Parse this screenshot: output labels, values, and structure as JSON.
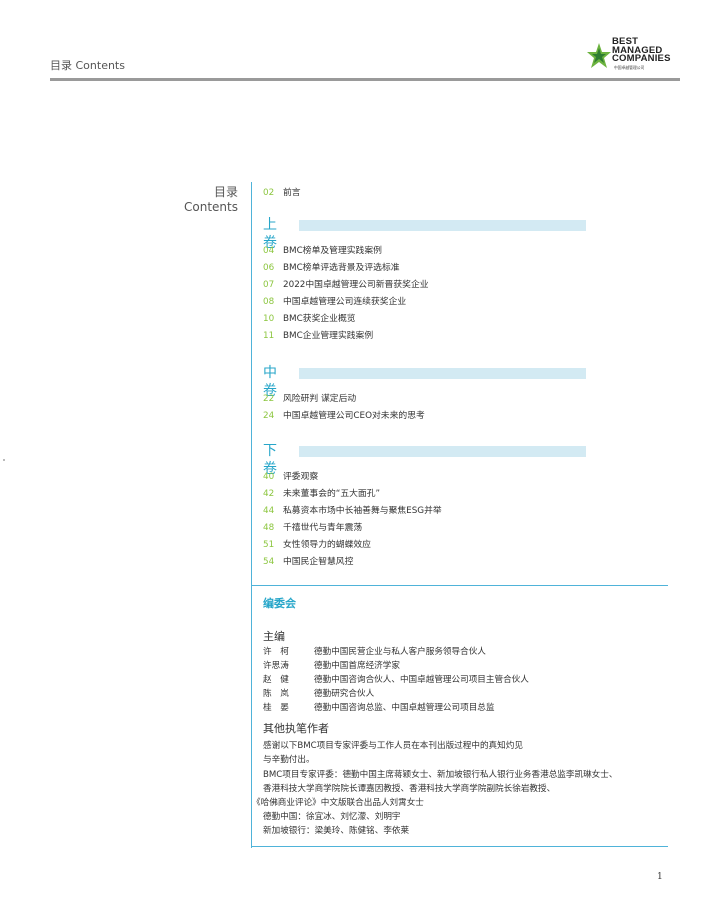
{
  "header": {
    "title": "目录 Contents",
    "logo_lines": [
      "BEST",
      "MANAGED",
      "COMPANIES"
    ],
    "logo_sub": "中国卓越管理公司"
  },
  "side": {
    "title_cn": "目录",
    "title_en": "Contents"
  },
  "toc": {
    "intro": {
      "page": "02",
      "label": "前言"
    },
    "volumes": [
      {
        "title": "上卷",
        "items": [
          {
            "page": "04",
            "label": "BMC榜单及管理实践案例"
          },
          {
            "page": "06",
            "label": "BMC榜单评选背景及评选标准"
          },
          {
            "page": "07",
            "label": "2022中国卓越管理公司新晋获奖企业"
          },
          {
            "page": "08",
            "label": "中国卓越管理公司连续获奖企业"
          },
          {
            "page": "10",
            "label": "BMC获奖企业概览"
          },
          {
            "page": "11",
            "label": "BMC企业管理实践案例"
          }
        ]
      },
      {
        "title": "中卷",
        "items": [
          {
            "page": "22",
            "label": "风险研判 谋定后动"
          },
          {
            "page": "24",
            "label": "中国卓越管理公司CEO对未来的思考"
          }
        ]
      },
      {
        "title": "下卷",
        "items": [
          {
            "page": "40",
            "label": "评委观察"
          },
          {
            "page": "42",
            "label": "未来董事会的“五大面孔”"
          },
          {
            "page": "44",
            "label": "私募资本市场中长袖善舞与聚焦ESG并举"
          },
          {
            "page": "48",
            "label": "千禧世代与青年震荡"
          },
          {
            "page": "51",
            "label": "女性领导力的蝴蝶效应"
          },
          {
            "page": "54",
            "label": "中国民企智慧风控"
          }
        ]
      }
    ]
  },
  "editorial": {
    "title": "编委会",
    "chief_label": "主编",
    "members": [
      {
        "name": "许　柯",
        "role": "德勤中国民营企业与私人客户服务领导合伙人"
      },
      {
        "name": "许思涛",
        "role": "德勤中国首席经济学家"
      },
      {
        "name": "赵　健",
        "role": "德勤中国咨询合伙人、中国卓越管理公司项目主管合伙人"
      },
      {
        "name": "陈　岚",
        "role": "德勤研究合伙人"
      },
      {
        "name": "桂　晏",
        "role": "德勤中国咨询总监、中国卓越管理公司项目总监"
      }
    ],
    "others_label": "其他执笔作者",
    "thanks_lines": [
      "感谢以下BMC项目专家评委与工作人员在本刊出版过程中的真知灼见",
      "与辛勤付出。"
    ],
    "credit_lines": [
      "BMC项目专家评委：德勤中国主席蒋颖女士、新加坡银行私人银行业务香港总监李凯琳女士、",
      "香港科技大学商学院院长谭嘉因教授、香港科技大学商学院副院长徐岩教授、",
      "《哈佛商业评论》中文版联合出品人刘霄女士",
      "德勤中国：徐宜冰、刘忆濛、刘明宇",
      "新加坡银行：梁美玲、陈健铭、李依莱"
    ]
  },
  "page_number": "1",
  "colors": {
    "accent_blue": "#27a6c9",
    "page_green": "#8cc63f",
    "bar_light_blue": "#d3eaf3",
    "rule_gray": "#9a9a9a"
  }
}
